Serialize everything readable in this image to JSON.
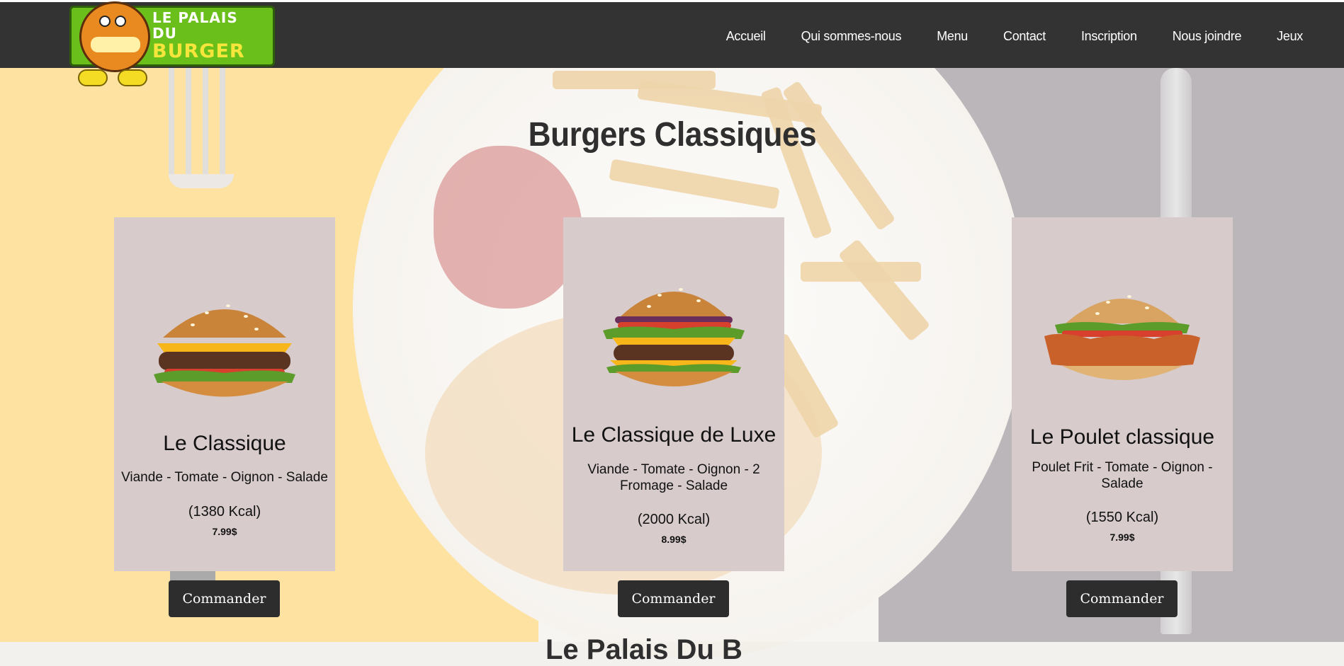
{
  "logo": {
    "line1": "LE PALAIS",
    "line2": "DU",
    "line3": "BURGER"
  },
  "nav": {
    "items": [
      "Accueil",
      "Qui sommes-nous",
      "Menu",
      "Contact",
      "Inscription",
      "Nous joindre",
      "Jeux"
    ]
  },
  "page": {
    "title": "Burgers Classiques",
    "next_section_peek": "Le Palais Du B"
  },
  "cards": [
    {
      "name": "Le Classique",
      "ingredients": "Viande - Tomate - Oignon - Salade",
      "kcal": "(1380 Kcal)",
      "price": "7.99$",
      "button": "Commander",
      "image": "burger-classique"
    },
    {
      "name": "Le Classique de Luxe",
      "ingredients": "Viande - Tomate - Oignon - 2 Fromage - Salade",
      "kcal": "(2000 Kcal)",
      "price": "8.99$",
      "button": "Commander",
      "image": "burger-luxe"
    },
    {
      "name": "Le Poulet classique",
      "ingredients": "Poulet Frit - Tomate - Oignon - Salade",
      "kcal": "(1550 Kcal)",
      "price": "7.99$",
      "button": "Commander",
      "image": "burger-poulet"
    }
  ],
  "colors": {
    "header": "#333333",
    "card": "#d7cbcc",
    "button": "#2d2d2d",
    "logo_green": "#6abf1b"
  }
}
